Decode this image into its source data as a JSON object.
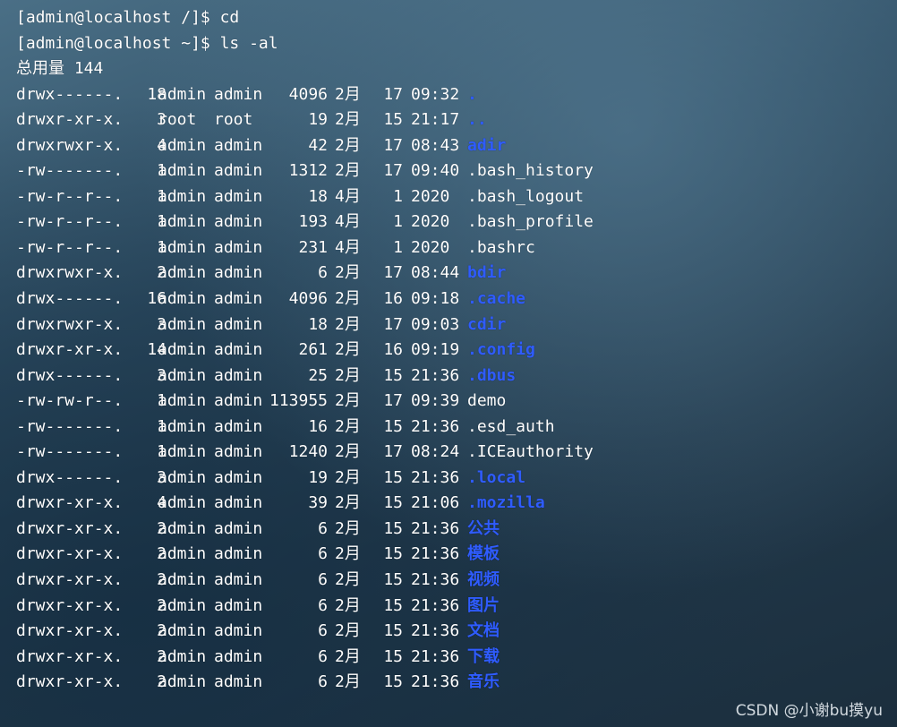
{
  "terminal": {
    "lines": [
      "[admin@localhost /]$ cd",
      "[admin@localhost ~]$ ls -al",
      "总用量 144"
    ],
    "entries": [
      {
        "perm": "drwx------.",
        "links": "18",
        "owner": "admin",
        "group": "admin",
        "size": "4096",
        "month": "2月",
        "day": "17",
        "time": "09:32",
        "name": ".",
        "type": "dir"
      },
      {
        "perm": "drwxr-xr-x.",
        "links": "3",
        "owner": "root",
        "group": "root",
        "size": "19",
        "month": "2月",
        "day": "15",
        "time": "21:17",
        "name": "..",
        "type": "dir"
      },
      {
        "perm": "drwxrwxr-x.",
        "links": "4",
        "owner": "admin",
        "group": "admin",
        "size": "42",
        "month": "2月",
        "day": "17",
        "time": "08:43",
        "name": "adir",
        "type": "dir"
      },
      {
        "perm": "-rw-------.",
        "links": "1",
        "owner": "admin",
        "group": "admin",
        "size": "1312",
        "month": "2月",
        "day": "17",
        "time": "09:40",
        "name": ".bash_history",
        "type": "file"
      },
      {
        "perm": "-rw-r--r--.",
        "links": "1",
        "owner": "admin",
        "group": "admin",
        "size": "18",
        "month": "4月",
        "day": "1",
        "time": "2020",
        "name": ".bash_logout",
        "type": "file"
      },
      {
        "perm": "-rw-r--r--.",
        "links": "1",
        "owner": "admin",
        "group": "admin",
        "size": "193",
        "month": "4月",
        "day": "1",
        "time": "2020",
        "name": ".bash_profile",
        "type": "file"
      },
      {
        "perm": "-rw-r--r--.",
        "links": "1",
        "owner": "admin",
        "group": "admin",
        "size": "231",
        "month": "4月",
        "day": "1",
        "time": "2020",
        "name": ".bashrc",
        "type": "file"
      },
      {
        "perm": "drwxrwxr-x.",
        "links": "2",
        "owner": "admin",
        "group": "admin",
        "size": "6",
        "month": "2月",
        "day": "17",
        "time": "08:44",
        "name": "bdir",
        "type": "dir"
      },
      {
        "perm": "drwx------.",
        "links": "16",
        "owner": "admin",
        "group": "admin",
        "size": "4096",
        "month": "2月",
        "day": "16",
        "time": "09:18",
        "name": ".cache",
        "type": "dir"
      },
      {
        "perm": "drwxrwxr-x.",
        "links": "3",
        "owner": "admin",
        "group": "admin",
        "size": "18",
        "month": "2月",
        "day": "17",
        "time": "09:03",
        "name": "cdir",
        "type": "dir"
      },
      {
        "perm": "drwxr-xr-x.",
        "links": "14",
        "owner": "admin",
        "group": "admin",
        "size": "261",
        "month": "2月",
        "day": "16",
        "time": "09:19",
        "name": ".config",
        "type": "dir"
      },
      {
        "perm": "drwx------.",
        "links": "3",
        "owner": "admin",
        "group": "admin",
        "size": "25",
        "month": "2月",
        "day": "15",
        "time": "21:36",
        "name": ".dbus",
        "type": "dir"
      },
      {
        "perm": "-rw-rw-r--.",
        "links": "1",
        "owner": "admin",
        "group": "admin",
        "size": "113955",
        "month": "2月",
        "day": "17",
        "time": "09:39",
        "name": "demo",
        "type": "file"
      },
      {
        "perm": "-rw-------.",
        "links": "1",
        "owner": "admin",
        "group": "admin",
        "size": "16",
        "month": "2月",
        "day": "15",
        "time": "21:36",
        "name": ".esd_auth",
        "type": "file"
      },
      {
        "perm": "-rw-------.",
        "links": "1",
        "owner": "admin",
        "group": "admin",
        "size": "1240",
        "month": "2月",
        "day": "17",
        "time": "08:24",
        "name": ".ICEauthority",
        "type": "file"
      },
      {
        "perm": "drwx------.",
        "links": "3",
        "owner": "admin",
        "group": "admin",
        "size": "19",
        "month": "2月",
        "day": "15",
        "time": "21:36",
        "name": ".local",
        "type": "dir"
      },
      {
        "perm": "drwxr-xr-x.",
        "links": "4",
        "owner": "admin",
        "group": "admin",
        "size": "39",
        "month": "2月",
        "day": "15",
        "time": "21:06",
        "name": ".mozilla",
        "type": "dir"
      },
      {
        "perm": "drwxr-xr-x.",
        "links": "2",
        "owner": "admin",
        "group": "admin",
        "size": "6",
        "month": "2月",
        "day": "15",
        "time": "21:36",
        "name": "公共",
        "type": "dir"
      },
      {
        "perm": "drwxr-xr-x.",
        "links": "2",
        "owner": "admin",
        "group": "admin",
        "size": "6",
        "month": "2月",
        "day": "15",
        "time": "21:36",
        "name": "模板",
        "type": "dir"
      },
      {
        "perm": "drwxr-xr-x.",
        "links": "2",
        "owner": "admin",
        "group": "admin",
        "size": "6",
        "month": "2月",
        "day": "15",
        "time": "21:36",
        "name": "视频",
        "type": "dir"
      },
      {
        "perm": "drwxr-xr-x.",
        "links": "2",
        "owner": "admin",
        "group": "admin",
        "size": "6",
        "month": "2月",
        "day": "15",
        "time": "21:36",
        "name": "图片",
        "type": "dir"
      },
      {
        "perm": "drwxr-xr-x.",
        "links": "2",
        "owner": "admin",
        "group": "admin",
        "size": "6",
        "month": "2月",
        "day": "15",
        "time": "21:36",
        "name": "文档",
        "type": "dir"
      },
      {
        "perm": "drwxr-xr-x.",
        "links": "2",
        "owner": "admin",
        "group": "admin",
        "size": "6",
        "month": "2月",
        "day": "15",
        "time": "21:36",
        "name": "下载",
        "type": "dir"
      },
      {
        "perm": "drwxr-xr-x.",
        "links": "2",
        "owner": "admin",
        "group": "admin",
        "size": "6",
        "month": "2月",
        "day": "15",
        "time": "21:36",
        "name": "音乐",
        "type": "dir"
      }
    ]
  },
  "watermark": "CSDN @小谢bu摸yu",
  "colors": {
    "text": "#ffffff",
    "directory": "#2f5cff"
  }
}
